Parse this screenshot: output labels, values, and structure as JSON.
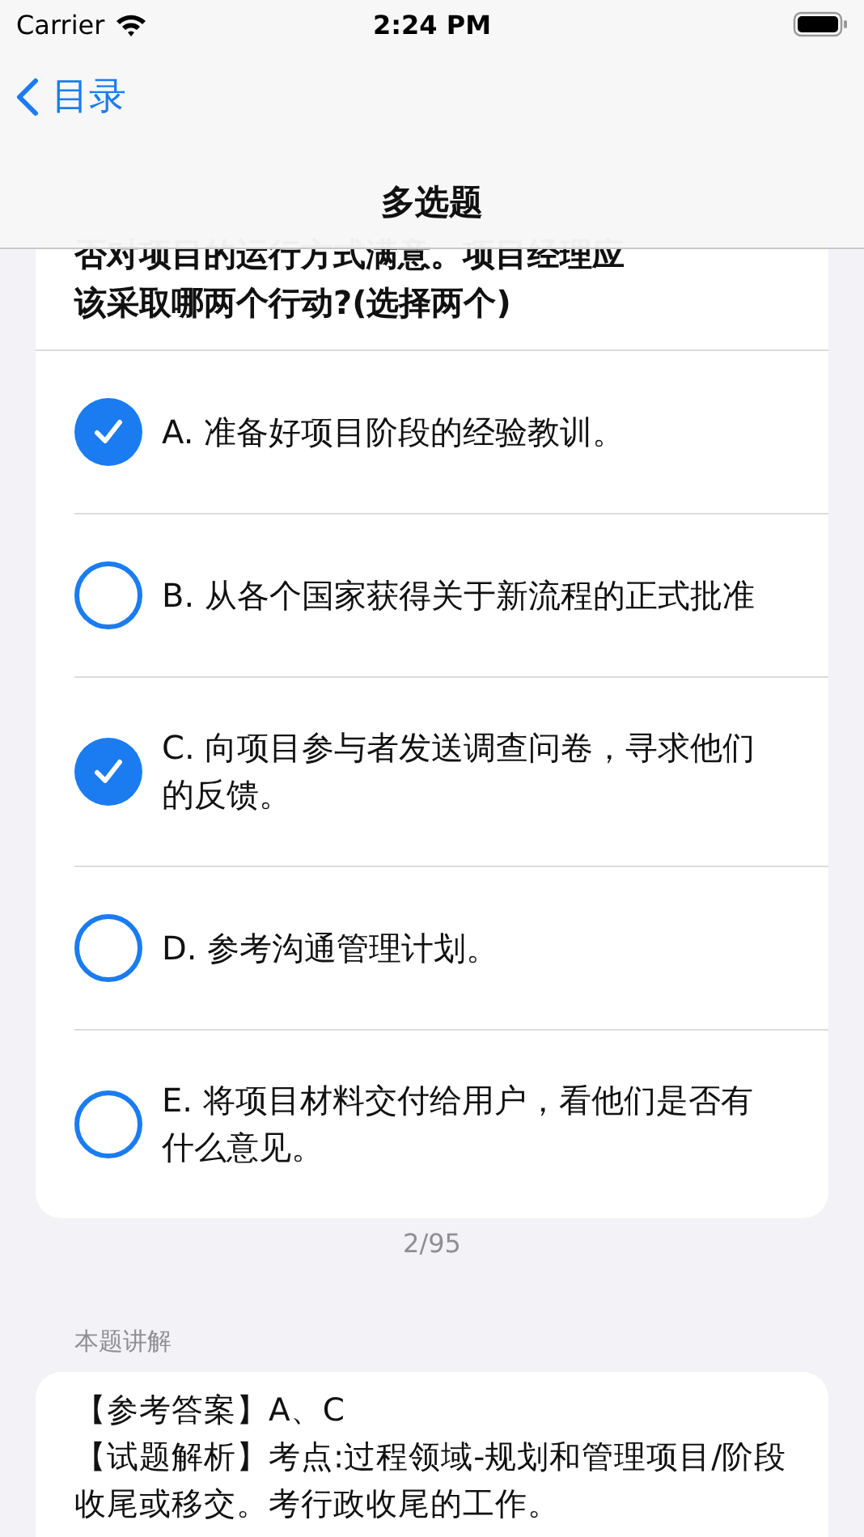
{
  "status_bar": {
    "carrier": "Carrier",
    "time": "2:24 PM"
  },
  "nav": {
    "back": "目录",
    "title": "多选题"
  },
  "question": {
    "lines": [
      "否对项目的运行方式满意。项目经理应",
      "该采取哪两个行动?(选择两个)"
    ]
  },
  "options": [
    {
      "text": "A. 准备好项目阶段的经验教训。",
      "checked": true
    },
    {
      "text": "B. 从各个国家获得关于新流程的正式批准",
      "checked": false
    },
    {
      "text": "C. 向项目参与者发送调查问卷，寻求他们的反馈。",
      "checked": true
    },
    {
      "text": "D. 参考沟通管理计划。",
      "checked": false
    },
    {
      "text": "E. 将项目材料交付给用户，看他们是否有什么意见。",
      "checked": false
    }
  ],
  "counter": "2/95",
  "explanation": {
    "heading": "本题讲解",
    "paragraphs": [
      "【参考答案】A、C",
      "【试题解析】考点:过程领域-规划和管理项目/阶段收尾或移交。考行政收尾的工作。"
    ]
  }
}
